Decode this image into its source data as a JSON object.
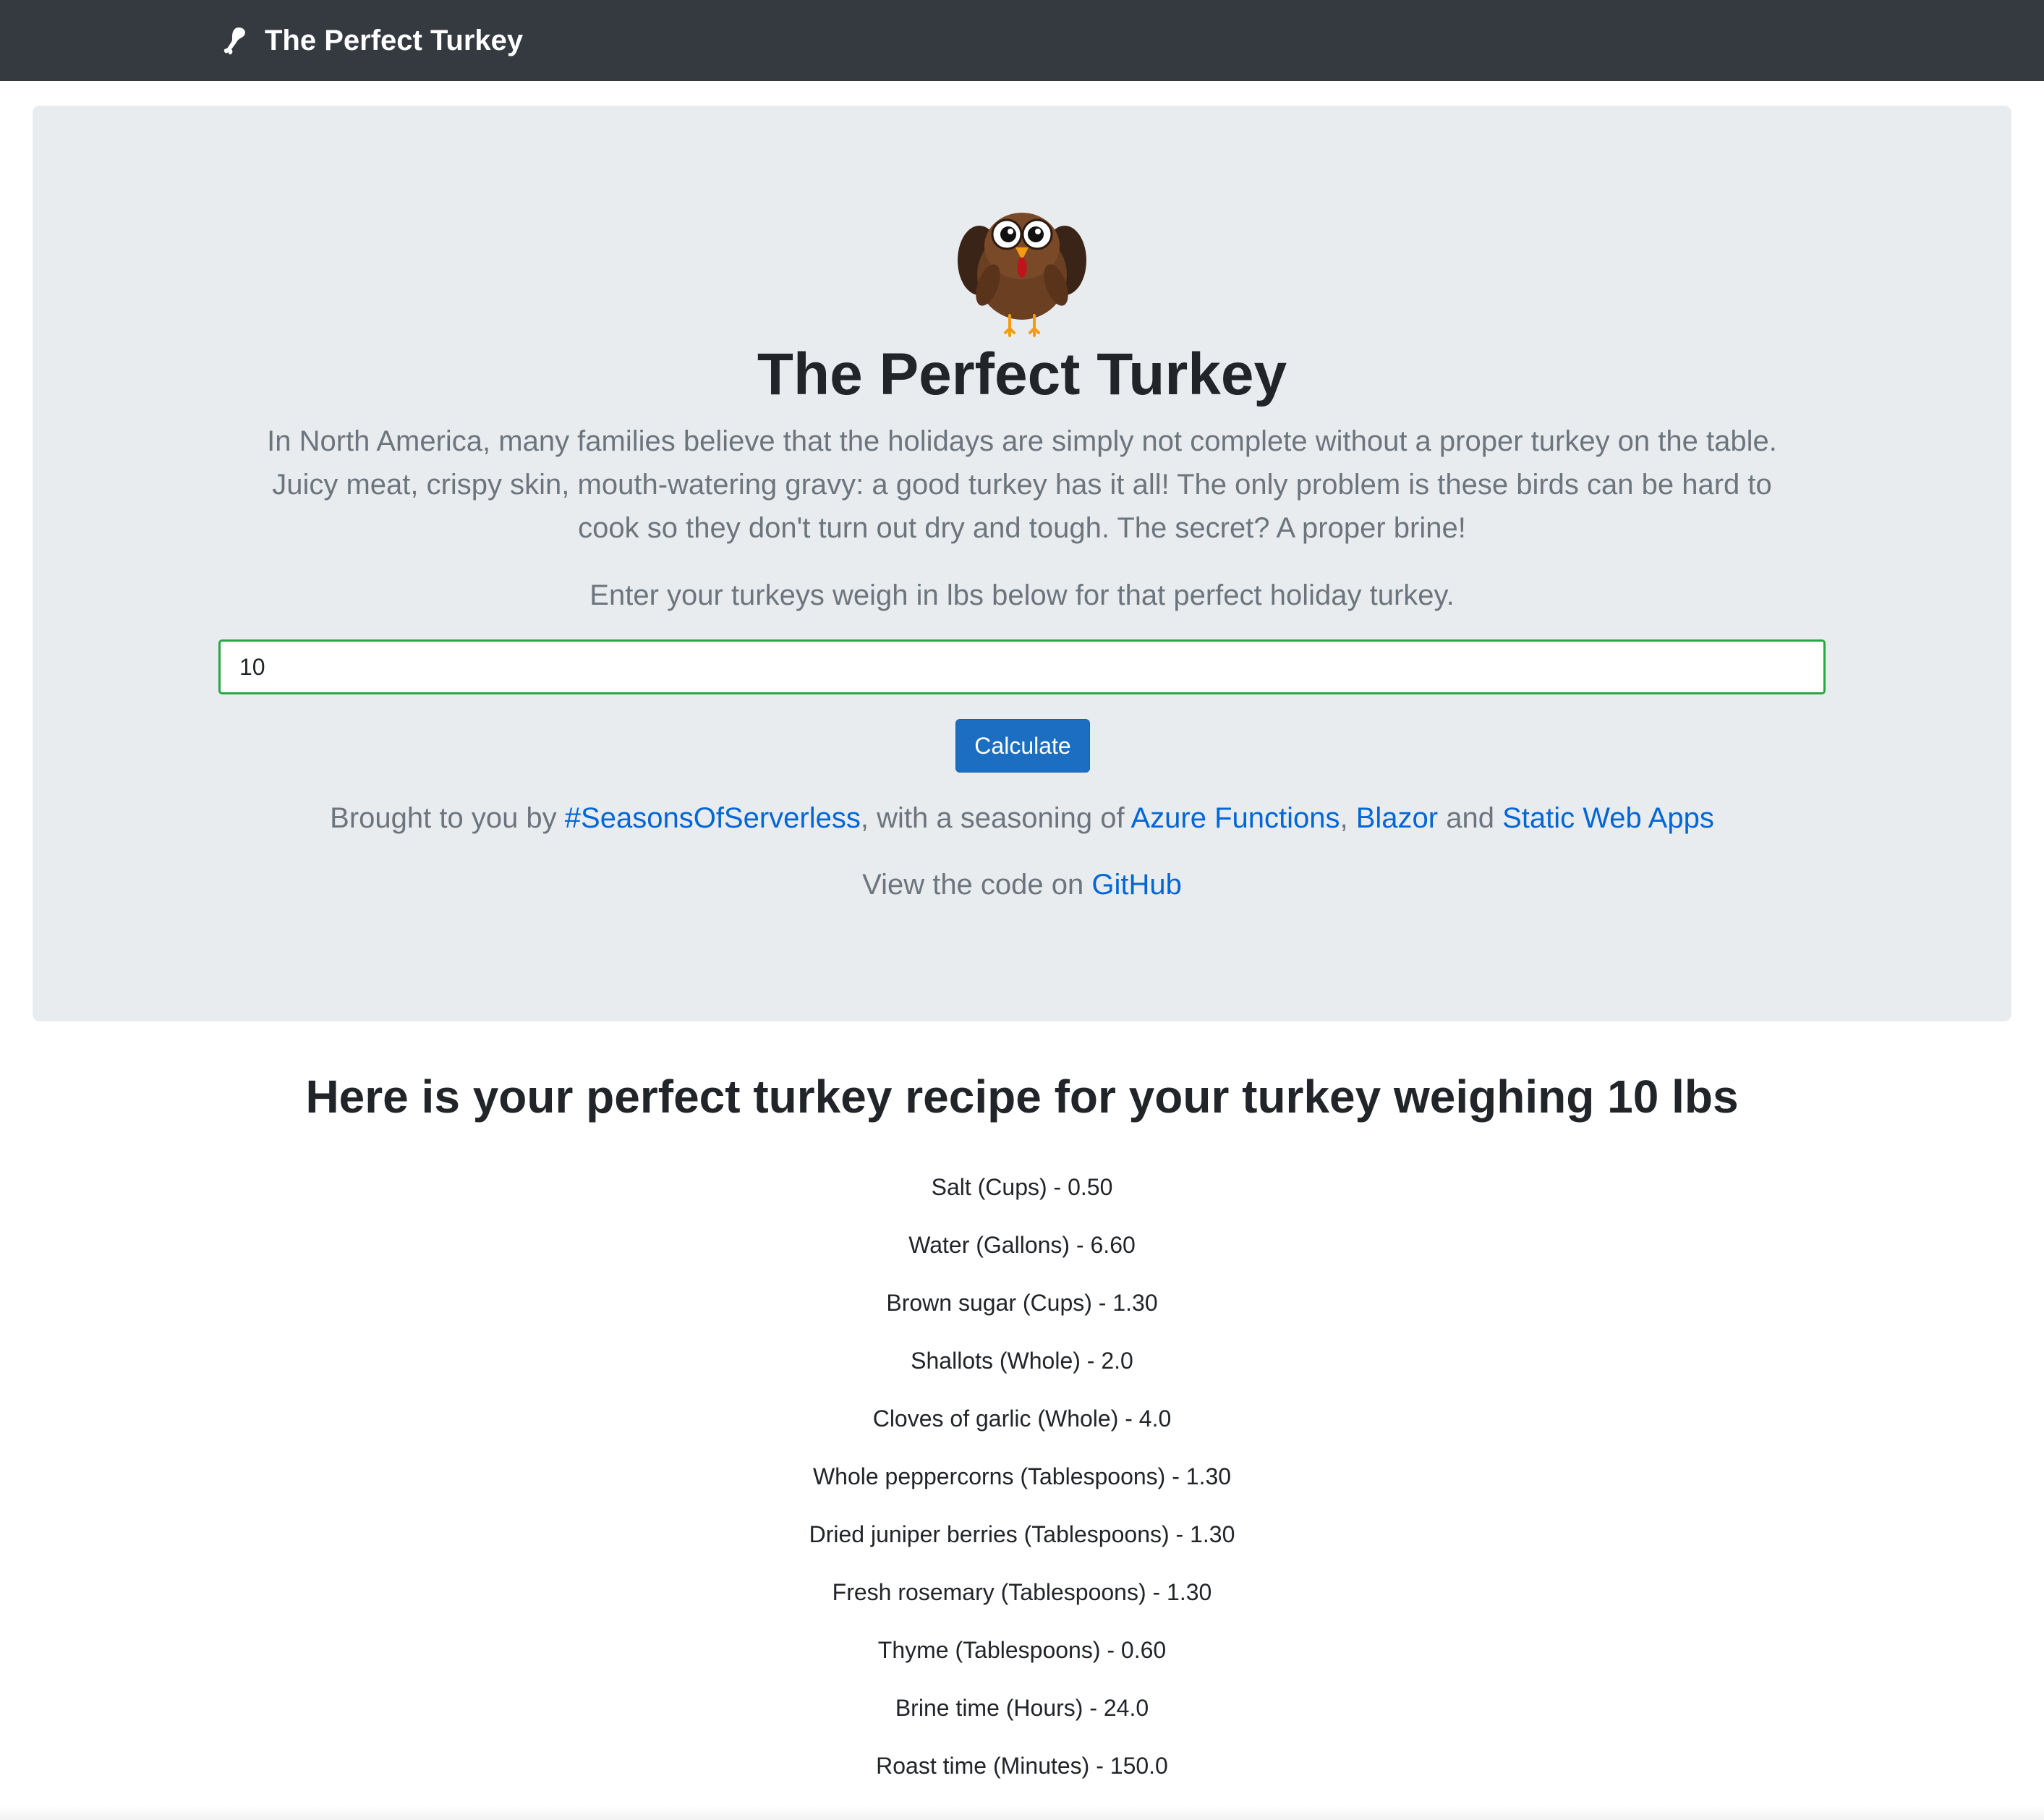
{
  "navbar": {
    "brand": "The Perfect Turkey",
    "brand_icon": "turkey-leg-icon"
  },
  "hero": {
    "image": "turkey-mascot-icon",
    "title": "The Perfect Turkey",
    "lead": "In North America, many families believe that the holidays are simply not complete without a proper turkey on the table. Juicy meat, crispy skin, mouth-watering gravy: a good turkey has it all! The only problem is these birds can be hard to cook so they don't turn out dry and tough. The secret? A proper brine!",
    "prompt": "Enter your turkeys weigh in lbs below for that perfect holiday turkey.",
    "weight_input": {
      "value": "10",
      "placeholder": ""
    },
    "calculate_label": "Calculate",
    "credits": {
      "prefix": "Brought to you by ",
      "seasons_link": "#SeasonsOfServerless",
      "middle": ", with a seasoning of ",
      "azure_link": "Azure Functions",
      "comma": ", ",
      "blazor_link": "Blazor",
      "and": " and ",
      "swa_link": "Static Web Apps"
    },
    "github": {
      "prefix": "View the code on ",
      "link": "GitHub"
    }
  },
  "recipe": {
    "heading": "Here is your perfect turkey recipe for your turkey weighing 10 lbs",
    "items": [
      "Salt (Cups) - 0.50",
      "Water (Gallons) - 6.60",
      "Brown sugar (Cups) - 1.30",
      "Shallots (Whole) - 2.0",
      "Cloves of garlic (Whole) - 4.0",
      "Whole peppercorns (Tablespoons) - 1.30",
      "Dried juniper berries (Tablespoons) - 1.30",
      "Fresh rosemary (Tablespoons) - 1.30",
      "Thyme (Tablespoons) - 0.60",
      "Brine time (Hours) - 24.0",
      "Roast time (Minutes) - 150.0"
    ]
  },
  "colors": {
    "navbar": "#343a40",
    "jumbotron": "#e9ecef",
    "link": "#0366d6",
    "button": "#1b6ec2",
    "input_border": "#28a745",
    "muted_text": "#6c757d"
  }
}
